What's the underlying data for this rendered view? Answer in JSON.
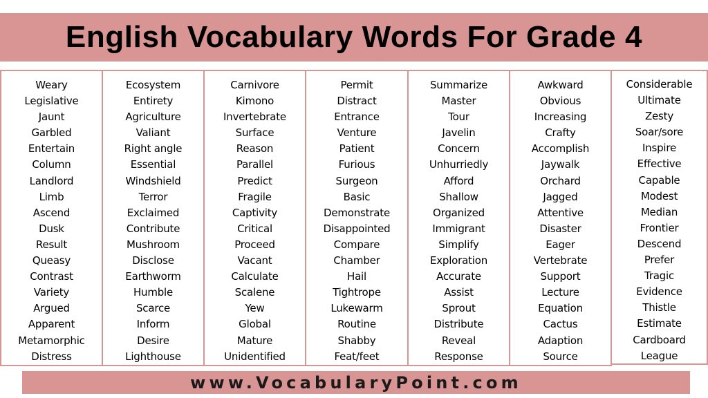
{
  "title": "English Vocabulary Words For Grade 4",
  "colors": {
    "accent": "#d99594",
    "text": "#000000",
    "background": "#ffffff"
  },
  "columns": [
    {
      "words": [
        "Weary",
        "Legislative",
        "Jaunt",
        "Garbled",
        "Entertain",
        "Column",
        "Landlord",
        "Limb",
        "Ascend",
        "Dusk",
        "Result",
        "Queasy",
        "Contrast",
        "Variety",
        "Argued",
        "Apparent",
        "Metamorphic",
        "Distress"
      ]
    },
    {
      "words": [
        "Ecosystem",
        "Entirety",
        "Agriculture",
        "Valiant",
        "Right angle",
        "Essential",
        "Windshield",
        "Terror",
        "Exclaimed",
        "Contribute",
        "Mushroom",
        "Disclose",
        "Earthworm",
        "Humble",
        "Scarce",
        "Inform",
        "Desire",
        "Lighthouse"
      ]
    },
    {
      "words": [
        "Carnivore",
        "Kimono",
        "Invertebrate",
        "Surface",
        "Reason",
        "Parallel",
        "Predict",
        "Fragile",
        "Captivity",
        "Critical",
        "Proceed",
        "Vacant",
        "Calculate",
        "Scalene",
        "Yew",
        "Global",
        "Mature",
        "Unidentified"
      ]
    },
    {
      "words": [
        "Permit",
        "Distract",
        "Entrance",
        "Venture",
        "Patient",
        "Furious",
        "Surgeon",
        "Basic",
        "Demonstrate",
        "Disappointed",
        "Compare",
        "Chamber",
        "Hail",
        "Tightrope",
        "Lukewarm",
        "Routine",
        "Shabby",
        "Feat/feet"
      ]
    },
    {
      "words": [
        "Summarize",
        "Master",
        "Tour",
        "Javelin",
        "Concern",
        "Unhurriedly",
        "Afford",
        "Shallow",
        "Organized",
        "Immigrant",
        "Simplify",
        "Exploration",
        "Accurate",
        "Assist",
        "Sprout",
        "Distribute",
        "Reveal",
        "Response"
      ]
    },
    {
      "words": [
        "Awkward",
        "Obvious",
        "Increasing",
        "Crafty",
        "Accomplish",
        "Jaywalk",
        "Orchard",
        "Jagged",
        "Attentive",
        "Disaster",
        "Eager",
        "Vertebrate",
        "Support",
        "Lecture",
        "Equation",
        "Cactus",
        "Adaption",
        "Source"
      ]
    },
    {
      "words": [
        "Considerable",
        "Ultimate",
        "Zesty",
        "Soar/sore",
        "Inspire",
        "Effective",
        "Capable",
        "Modest",
        "Median",
        "Frontier",
        "Descend",
        "Prefer",
        "Tragic",
        "Evidence",
        "Thistle",
        "Estimate",
        "Cardboard",
        "League"
      ]
    }
  ],
  "footer": {
    "url": "www.VocabularyPoint.com"
  }
}
